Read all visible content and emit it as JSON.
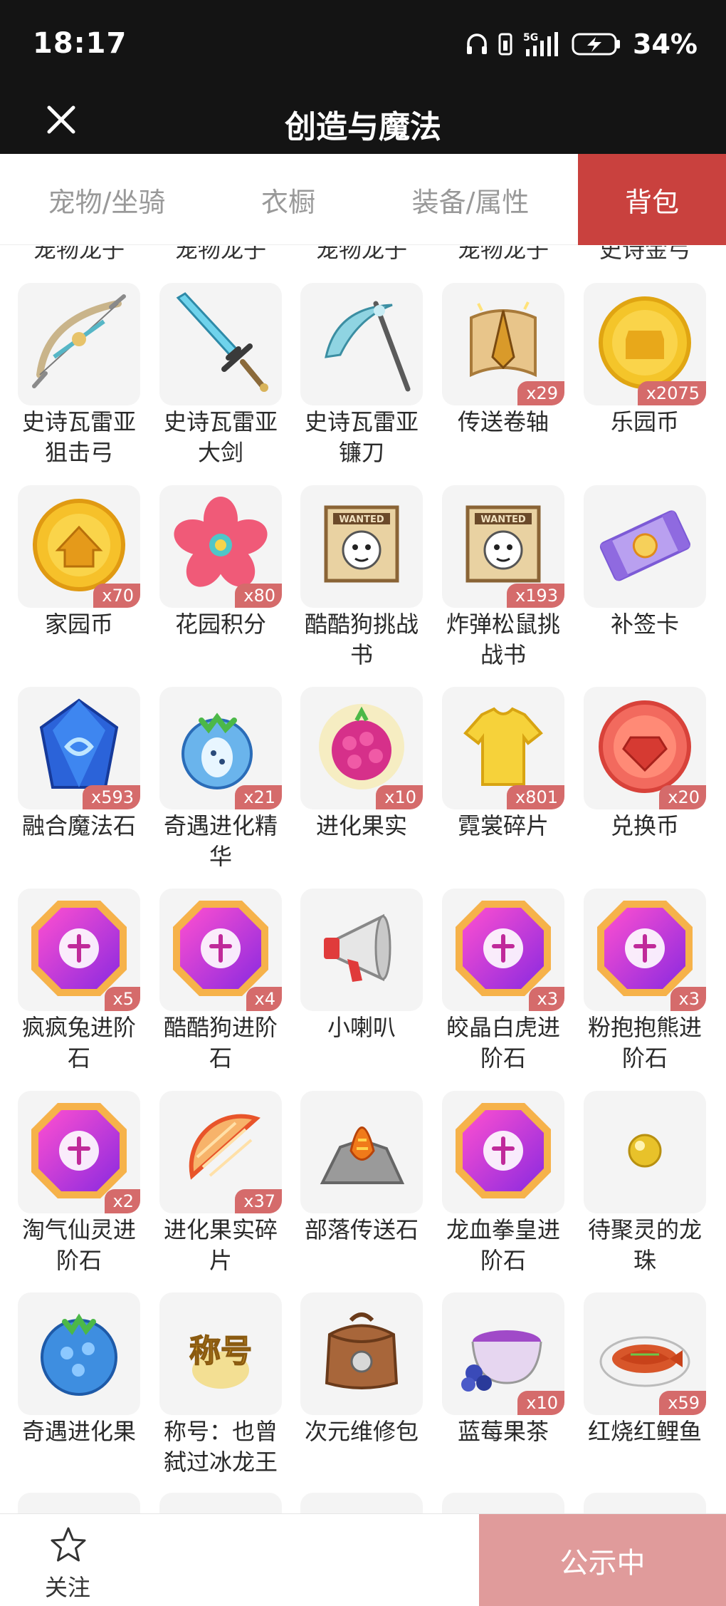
{
  "status_bar": {
    "time": "18:17",
    "network": "5G",
    "battery": "34%"
  },
  "header": {
    "title": "创造与魔法",
    "close_icon": "close-icon"
  },
  "tabs": [
    {
      "label": "宠物/坐骑",
      "active": false
    },
    {
      "label": "衣橱",
      "active": false
    },
    {
      "label": "装备/属性",
      "active": false
    },
    {
      "label": "背包",
      "active": true
    }
  ],
  "cut_row_labels": [
    "宠物龙子",
    "宠物龙子",
    "宠物龙子",
    "宠物龙子",
    "史诗金弓"
  ],
  "items": [
    {
      "name": "史诗瓦雷亚\n狙击弓",
      "qty": "",
      "icon": "bow-icon"
    },
    {
      "name": "史诗瓦雷亚\n大剑",
      "qty": "",
      "icon": "sword-icon"
    },
    {
      "name": "史诗瓦雷亚\n镰刀",
      "qty": "",
      "icon": "scythe-icon"
    },
    {
      "name": "传送卷轴",
      "qty": "x29",
      "icon": "scroll-icon"
    },
    {
      "name": "乐园币",
      "qty": "x2075",
      "icon": "coin-icon"
    },
    {
      "name": "家园币",
      "qty": "x70",
      "icon": "home-coin-icon"
    },
    {
      "name": "花园积分",
      "qty": "x80",
      "icon": "flower-icon"
    },
    {
      "name": "酷酷狗挑战\n书",
      "qty": "",
      "icon": "wanted-poster-icon"
    },
    {
      "name": "炸弹松鼠挑\n战书",
      "qty": "x193",
      "icon": "wanted-poster-icon"
    },
    {
      "name": "补签卡",
      "qty": "",
      "icon": "ticket-icon"
    },
    {
      "name": "融合魔法石",
      "qty": "x593",
      "icon": "crystal-icon"
    },
    {
      "name": "奇遇进化精\n华",
      "qty": "x21",
      "icon": "essence-icon"
    },
    {
      "name": "进化果实",
      "qty": "x10",
      "icon": "berry-icon"
    },
    {
      "name": "霓裳碎片",
      "qty": "x801",
      "icon": "shirt-icon"
    },
    {
      "name": "兑换币",
      "qty": "x20",
      "icon": "gem-coin-icon"
    },
    {
      "name": "疯疯兔进阶\n石",
      "qty": "x5",
      "icon": "advance-stone-icon"
    },
    {
      "name": "酷酷狗进阶\n石",
      "qty": "x4",
      "icon": "advance-stone-icon"
    },
    {
      "name": "小喇叭",
      "qty": "",
      "icon": "megaphone-icon"
    },
    {
      "name": "皎晶白虎进\n阶石",
      "qty": "x3",
      "icon": "advance-stone-icon"
    },
    {
      "name": "粉抱抱熊进\n阶石",
      "qty": "x3",
      "icon": "advance-stone-icon"
    },
    {
      "name": "淘气仙灵进\n阶石",
      "qty": "x2",
      "icon": "advance-stone-icon"
    },
    {
      "name": "进化果实碎\n片",
      "qty": "x37",
      "icon": "fruit-slice-icon"
    },
    {
      "name": "部落传送石",
      "qty": "",
      "icon": "portal-stone-icon"
    },
    {
      "name": "龙血拳皇进\n阶石",
      "qty": "",
      "icon": "advance-stone-icon"
    },
    {
      "name": "待聚灵的龙\n珠",
      "qty": "",
      "icon": "orb-icon"
    },
    {
      "name": "奇遇进化果",
      "qty": "",
      "icon": "blue-fruit-icon"
    },
    {
      "name": "称号：也曾\n弑过冰龙王",
      "qty": "",
      "icon": "title-badge-icon",
      "badge_text": "称号"
    },
    {
      "name": "次元维修包",
      "qty": "",
      "icon": "repair-bag-icon"
    },
    {
      "name": "蓝莓果茶",
      "qty": "x10",
      "icon": "tea-icon"
    },
    {
      "name": "红烧红鲤鱼",
      "qty": "x59",
      "icon": "fish-dish-icon"
    }
  ],
  "bottom_bar": {
    "follow_label": "关注",
    "public_label": "公示中"
  },
  "colors": {
    "accent": "#c9413e",
    "public_button": "#e09b9b",
    "badge": "#d56b6b"
  }
}
